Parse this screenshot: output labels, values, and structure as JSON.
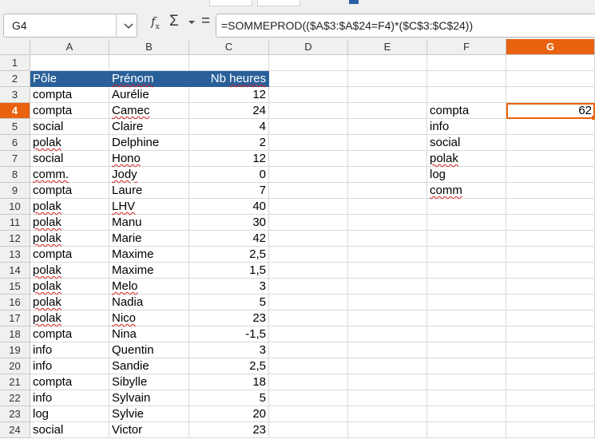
{
  "formula_bar": {
    "name_box": "G4",
    "formula": "=SOMMEPROD(($A$3:$A$24=F4)*($C$3:$C$24))"
  },
  "columns": [
    "A",
    "B",
    "C",
    "D",
    "E",
    "F",
    "G"
  ],
  "active_column": "G",
  "active_row": "4",
  "rows": [
    {
      "n": "1"
    },
    {
      "n": "2",
      "A": "Pôle",
      "B": "Prénom",
      "C": "Nb heures",
      "header": true
    },
    {
      "n": "3",
      "A": "compta",
      "B": "Aurélie",
      "C": "12"
    },
    {
      "n": "4",
      "A": "compta",
      "B": "Camec",
      "C": "24",
      "F": "compta",
      "G": "62"
    },
    {
      "n": "5",
      "A": "social",
      "B": "Claire",
      "C": "4",
      "F": "info"
    },
    {
      "n": "6",
      "A": "polak",
      "B": "Delphine",
      "C": "2",
      "F": "social"
    },
    {
      "n": "7",
      "A": "social",
      "B": "Hono",
      "C": "12",
      "F": "polak"
    },
    {
      "n": "8",
      "A": "comm.",
      "B": "Jody",
      "C": "0",
      "F": "log"
    },
    {
      "n": "9",
      "A": "compta",
      "B": "Laure",
      "C": "7",
      "F": "comm"
    },
    {
      "n": "10",
      "A": "polak",
      "B": "LHV",
      "C": "40"
    },
    {
      "n": "11",
      "A": "polak",
      "B": "Manu",
      "C": "30"
    },
    {
      "n": "12",
      "A": "polak",
      "B": "Marie",
      "C": "42"
    },
    {
      "n": "13",
      "A": "compta",
      "B": "Maxime",
      "C": "2,5"
    },
    {
      "n": "14",
      "A": "polak",
      "B": "Maxime",
      "C": "1,5"
    },
    {
      "n": "15",
      "A": "polak",
      "B": "Melo",
      "C": "3"
    },
    {
      "n": "16",
      "A": "polak",
      "B": "Nadia",
      "C": "5"
    },
    {
      "n": "17",
      "A": "polak",
      "B": "Nico",
      "C": "23"
    },
    {
      "n": "18",
      "A": "compta",
      "B": "Nina",
      "C": "-1,5"
    },
    {
      "n": "19",
      "A": "info",
      "B": "Quentin",
      "C": "3"
    },
    {
      "n": "20",
      "A": "info",
      "B": "Sandie",
      "C": "2,5"
    },
    {
      "n": "21",
      "A": "compta",
      "B": "Sibylle",
      "C": "18"
    },
    {
      "n": "22",
      "A": "info",
      "B": "Sylvain",
      "C": "5"
    },
    {
      "n": "23",
      "A": "log",
      "B": "Sylvie",
      "C": "20"
    },
    {
      "n": "24",
      "A": "social",
      "B": "Victor",
      "C": "23"
    }
  ],
  "spellcheck_words": [
    "polak",
    "comm.",
    "comm",
    "Camec",
    "Hono",
    "Jody",
    "LHV",
    "Melo",
    "Nico",
    "Prénom",
    "heures"
  ],
  "colors": {
    "accent": "#e8620f",
    "header_fill": "#2a6099",
    "spell_underline": "#d62020"
  }
}
